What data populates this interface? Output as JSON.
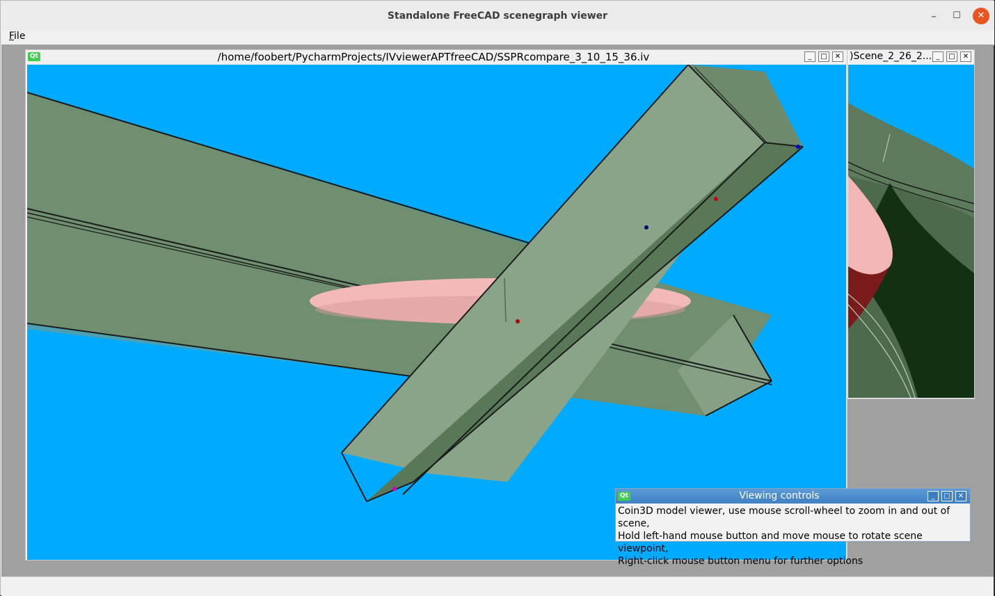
{
  "app": {
    "title": "Standalone FreeCAD scenegraph viewer"
  },
  "window_controls": {
    "minimize": "–",
    "maximize": "☐",
    "close": "✕"
  },
  "menu": {
    "file_first": "F",
    "file_rest": "ile"
  },
  "subwindow_badge": "Qt",
  "subwin_buttons": {
    "minimize": "_",
    "restore": "□",
    "close": "✕"
  },
  "subwindow_main": {
    "title": "/home/foobert/PycharmProjects/IVviewerAPTfreeCAD/SSPRcompare_3_10_15_36.iv"
  },
  "subwindow_back": {
    "title": ")Scene_2_26_2..."
  },
  "viewing_controls": {
    "title": "Viewing controls",
    "lines": [
      "Coin3D model viewer, use mouse scroll-wheel to zoom in and out of scene,",
      "Hold left-hand mouse button and move mouse to rotate scene viewpoint,",
      "Right-click mouse button menu for further options"
    ]
  },
  "colors": {
    "viewport_bg": "#00aaff",
    "model_green": "#7f9a7f",
    "ellipsoid_pink": "#f2b8b8",
    "accent": "#e95420"
  },
  "icons": {
    "close": "close-icon",
    "maximize": "maximize-icon",
    "minimize": "minimize-icon"
  }
}
